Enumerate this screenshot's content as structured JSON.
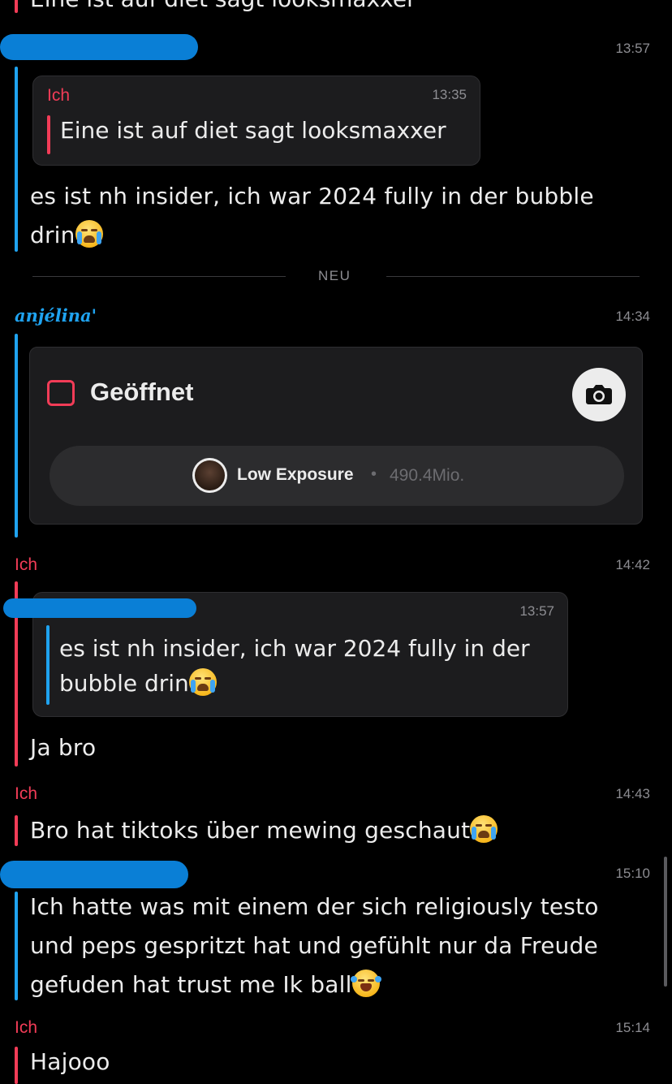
{
  "top_partial_text": "Eine ist auf diet sagt looksmaxxer",
  "messages": {
    "m1": {
      "time": "13:57",
      "quote": {
        "author": "Ich",
        "time": "13:35",
        "text": "Eine ist auf diet sagt looksmaxxer"
      },
      "line1": "es ist nh insider, ich war 2024 fully in der bubble",
      "line2": "drin",
      "emoji": "loudly-crying-face"
    },
    "divider_label": "NEU",
    "m2": {
      "sender": "anjélina'",
      "time": "14:34",
      "card": {
        "status": "Geöffnet",
        "chip_name": "Low Exposure",
        "chip_separator": "•",
        "chip_count": "490.4Mio."
      }
    },
    "m3": {
      "sender": "Ich",
      "time": "14:42",
      "quote": {
        "time": "13:57",
        "line1": "es ist nh insider, ich war 2024 fully in der",
        "line2": "bubble drin"
      },
      "text": "Ja bro"
    },
    "m4": {
      "sender": "Ich",
      "time": "14:43",
      "text": "Bro hat tiktoks über mewing geschaut"
    },
    "m5": {
      "time": "15:10",
      "line1": "Ich hatte was mit einem der sich religiously testo",
      "line2": "und peps gespritzt hat und gefühlt nur da Freude",
      "line3": "gefuden hat trust me Ik ball"
    },
    "m6": {
      "sender": "Ich",
      "time": "15:14",
      "text": "Hajooo"
    }
  },
  "colors": {
    "background": "#000000",
    "accent_red": "#f23c57",
    "accent_blue": "#1fa3f0",
    "bubble": "#1c1c1e",
    "redaction": "#0a7fd6"
  }
}
